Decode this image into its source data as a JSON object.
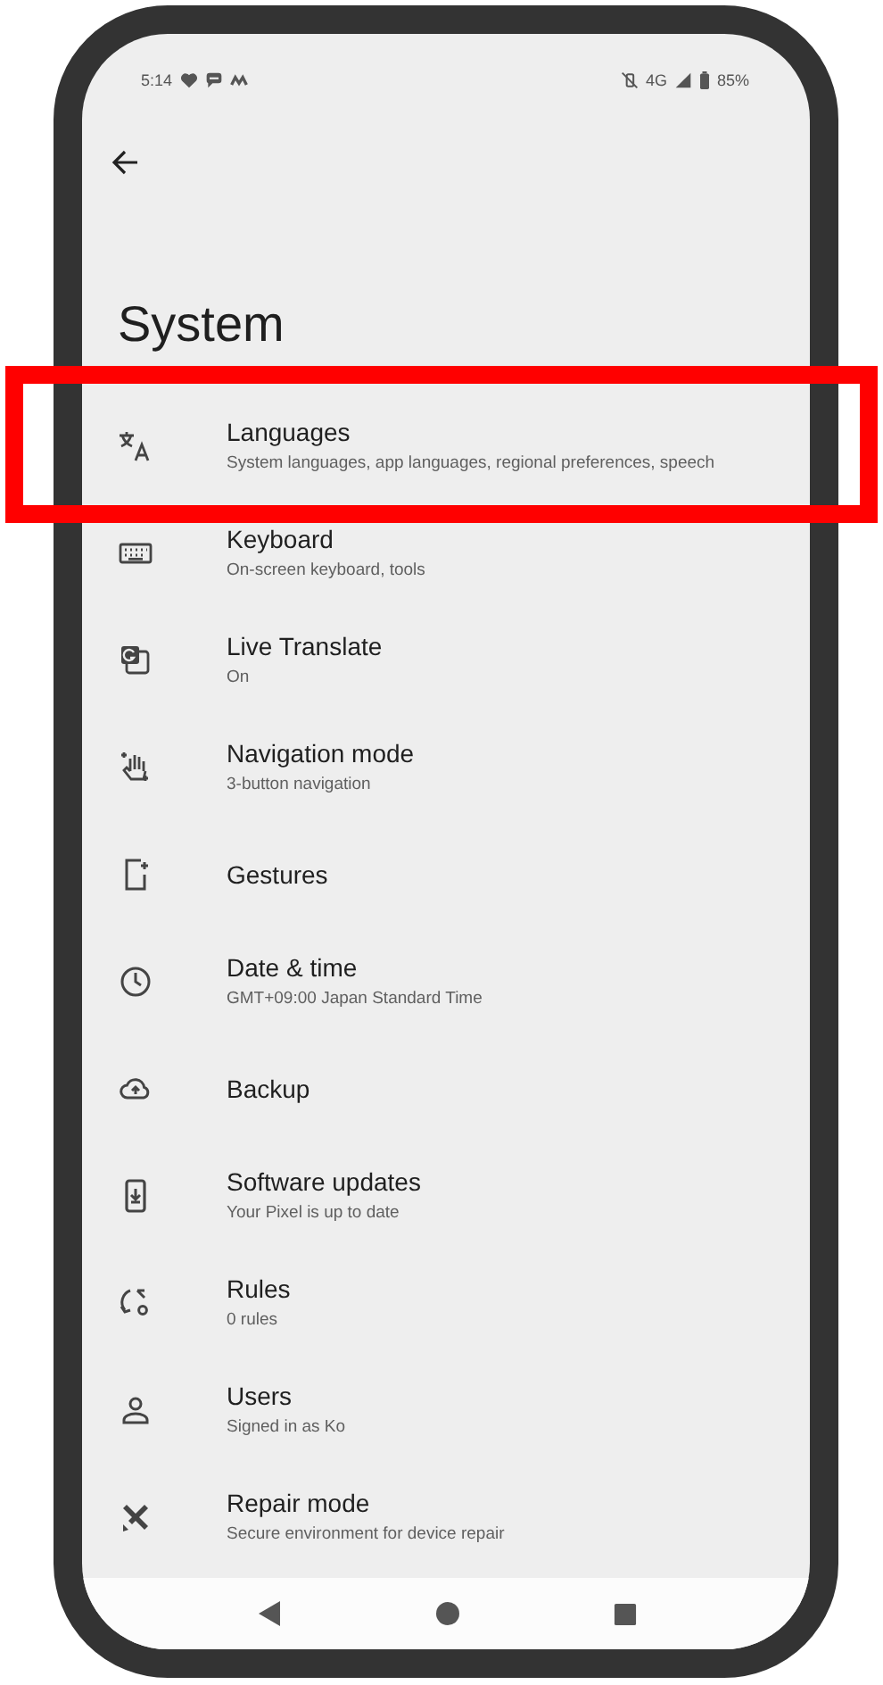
{
  "status_bar": {
    "time": "5:14",
    "network": "4G",
    "battery": "85%"
  },
  "title": "System",
  "items": [
    {
      "title": "Languages",
      "subtitle": "System languages, app languages, regional preferences, speech",
      "highlighted": true
    },
    {
      "title": "Keyboard",
      "subtitle": "On-screen keyboard, tools",
      "highlighted": false
    },
    {
      "title": "Live Translate",
      "subtitle": "On",
      "highlighted": false
    },
    {
      "title": "Navigation mode",
      "subtitle": "3-button navigation",
      "highlighted": false
    },
    {
      "title": "Gestures",
      "highlighted": false
    },
    {
      "title": "Date & time",
      "subtitle": "GMT+09:00 Japan Standard Time",
      "highlighted": false
    },
    {
      "title": "Backup",
      "highlighted": false
    },
    {
      "title": "Software updates",
      "subtitle": "Your Pixel is up to date",
      "highlighted": false
    },
    {
      "title": "Rules",
      "subtitle": "0 rules",
      "highlighted": false
    },
    {
      "title": "Users",
      "subtitle": "Signed in as Ko",
      "highlighted": false
    },
    {
      "title": "Repair mode",
      "subtitle": "Secure environment for device repair",
      "highlighted": false
    }
  ]
}
